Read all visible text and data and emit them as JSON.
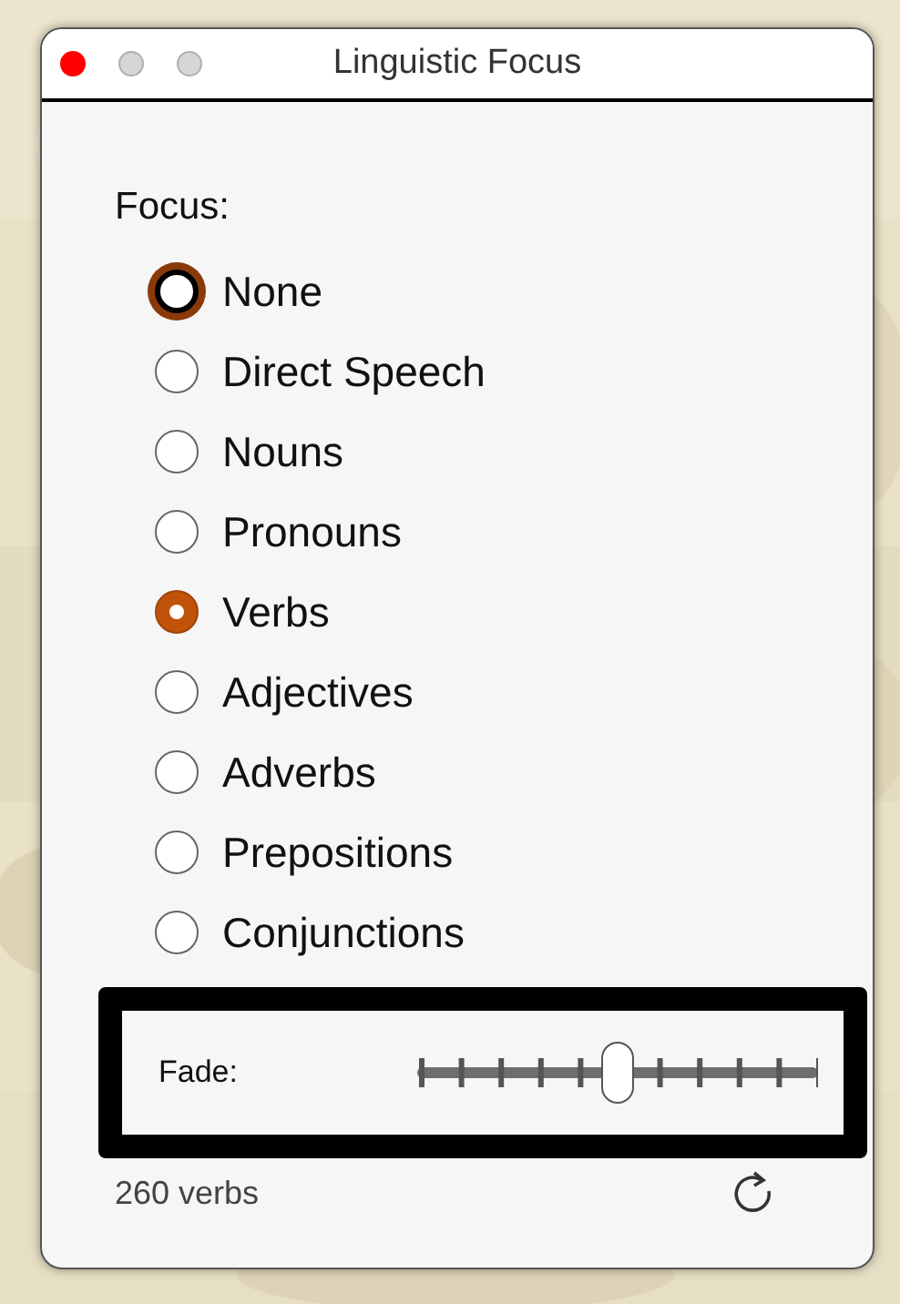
{
  "window": {
    "title": "Linguistic Focus"
  },
  "focus": {
    "label": "Focus:",
    "options": [
      {
        "label": "None",
        "selected": false,
        "focused": true
      },
      {
        "label": "Direct Speech",
        "selected": false,
        "focused": false
      },
      {
        "label": "Nouns",
        "selected": false,
        "focused": false
      },
      {
        "label": "Pronouns",
        "selected": false,
        "focused": false
      },
      {
        "label": "Verbs",
        "selected": true,
        "focused": false
      },
      {
        "label": "Adjectives",
        "selected": false,
        "focused": false
      },
      {
        "label": "Adverbs",
        "selected": false,
        "focused": false
      },
      {
        "label": "Prepositions",
        "selected": false,
        "focused": false
      },
      {
        "label": "Conjunctions",
        "selected": false,
        "focused": false
      }
    ]
  },
  "fade": {
    "label": "Fade:",
    "level": 0.5
  },
  "status": {
    "count": "260 verbs"
  }
}
